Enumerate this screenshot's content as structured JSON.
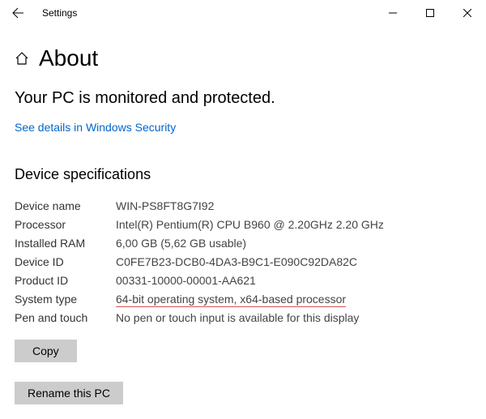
{
  "titlebar": {
    "title": "Settings"
  },
  "header": {
    "page_title": "About"
  },
  "protection": {
    "status": "Your PC is monitored and protected.",
    "link": "See details in Windows Security"
  },
  "specs": {
    "section_title": "Device specifications",
    "rows": {
      "device_name": {
        "label": "Device name",
        "value": "WIN-PS8FT8G7I92"
      },
      "processor": {
        "label": "Processor",
        "value": "Intel(R) Pentium(R) CPU B960 @ 2.20GHz   2.20 GHz"
      },
      "ram": {
        "label": "Installed RAM",
        "value": "6,00 GB (5,62 GB usable)"
      },
      "device_id": {
        "label": "Device ID",
        "value": "C0FE7B23-DCB0-4DA3-B9C1-E090C92DA82C"
      },
      "product_id": {
        "label": "Product ID",
        "value": "00331-10000-00001-AA621"
      },
      "system_type": {
        "label": "System type",
        "value": "64-bit operating system, x64-based processor"
      },
      "pen_touch": {
        "label": "Pen and touch",
        "value": "No pen or touch input is available for this display"
      }
    }
  },
  "buttons": {
    "copy": "Copy",
    "rename": "Rename this PC"
  }
}
